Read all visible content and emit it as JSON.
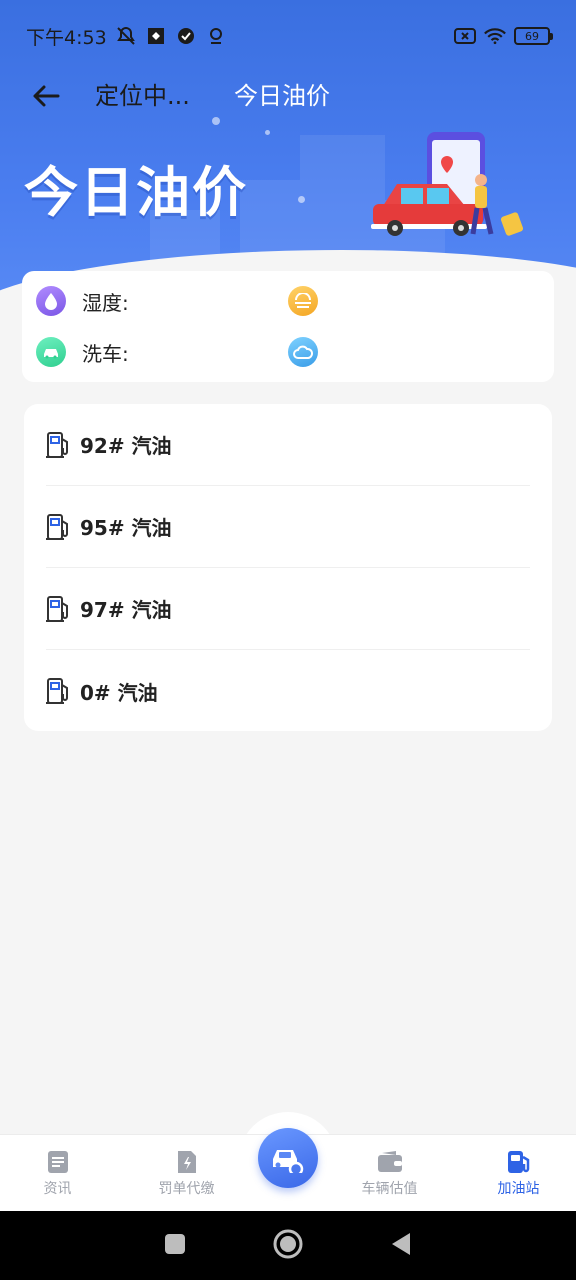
{
  "status_bar": {
    "time": "下午4:53",
    "battery": "69"
  },
  "topbar": {
    "location": "定位中...",
    "title": "今日油价"
  },
  "hero": {
    "title": "今日油价"
  },
  "weather": {
    "humidity_label": "湿度:",
    "carwash_label": "洗车:"
  },
  "fuel_list": [
    {
      "label": "92# 汽油"
    },
    {
      "label": "95# 汽油"
    },
    {
      "label": "97# 汽油"
    },
    {
      "label": "0# 汽油"
    }
  ],
  "bottom_nav": {
    "items": [
      {
        "label": "资讯",
        "icon": "news-icon"
      },
      {
        "label": "罚单代缴",
        "icon": "ticket-icon"
      },
      {
        "label": "车辆估值",
        "icon": "wallet-icon"
      },
      {
        "label": "加油站",
        "icon": "gas-station-icon"
      }
    ],
    "active_color": "#2e63e5",
    "inactive_color": "#a0a4ad"
  },
  "colors": {
    "hero_blue": "#3a6fe0",
    "background": "#f5f5f5"
  }
}
